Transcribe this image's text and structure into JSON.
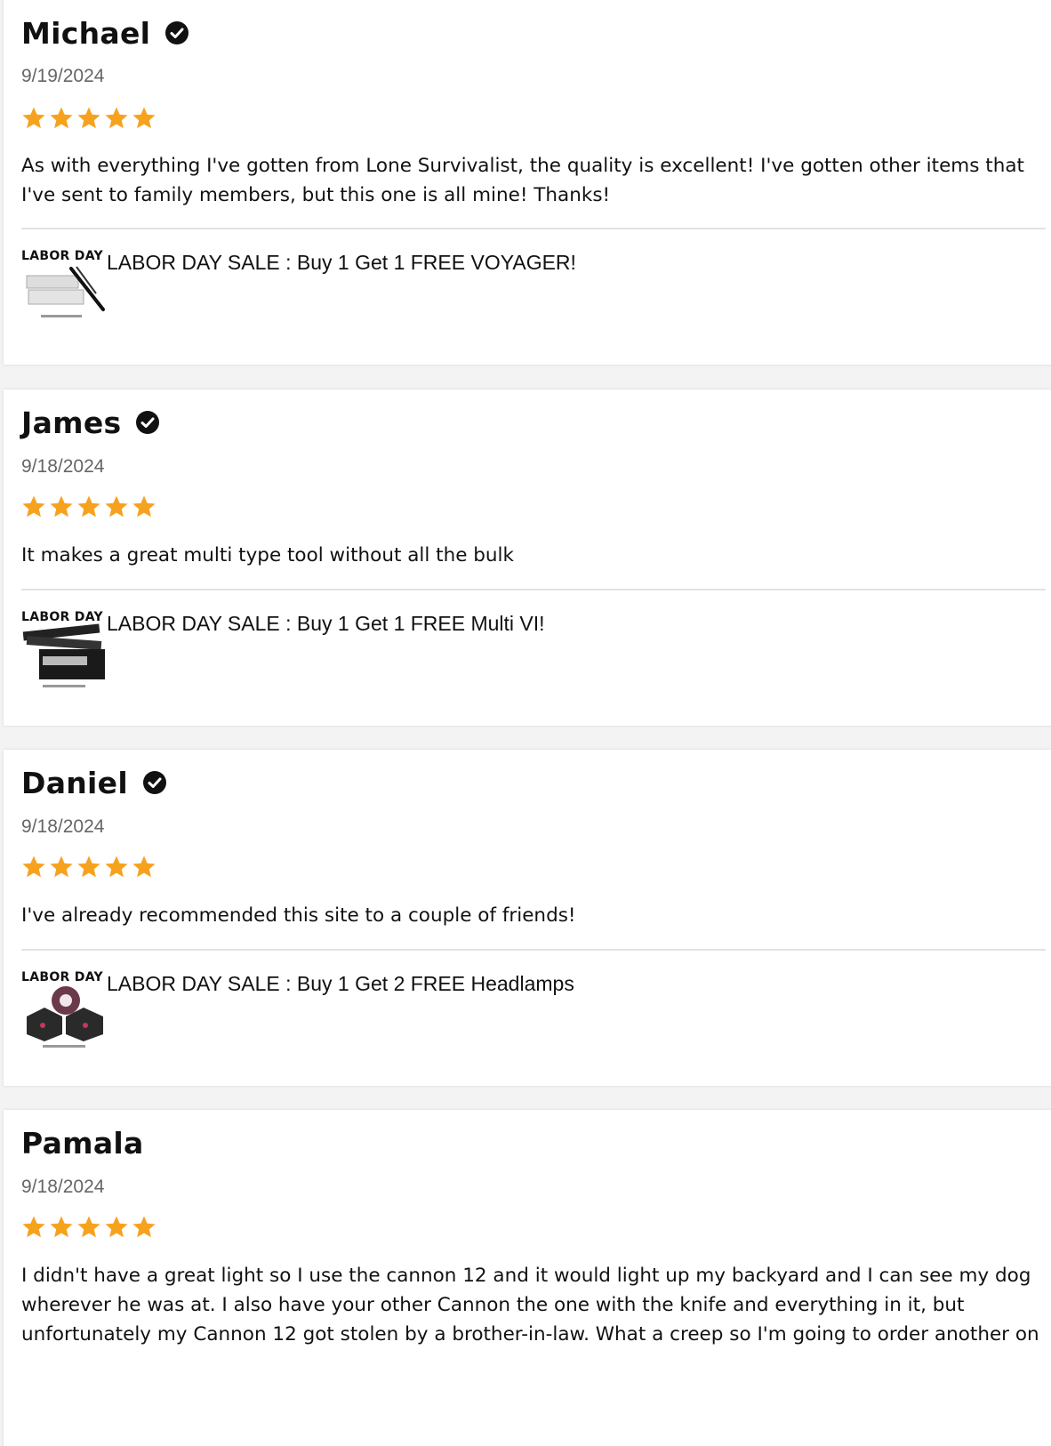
{
  "reviews": [
    {
      "name": "Michael",
      "verified": true,
      "date": "9/19/2024",
      "rating": 5,
      "body": "As with everything I've gotten from Lone Survivalist, the quality is excellent! I've gotten other items that I've sent to family members, but this one is all mine! Thanks!",
      "product": {
        "thumb_label": "LABOR DAY",
        "thumb_icon": "voyager-product-icon",
        "title": "LABOR DAY SALE : Buy 1 Get 1 FREE VOYAGER!"
      }
    },
    {
      "name": "James",
      "verified": true,
      "date": "9/18/2024",
      "rating": 5,
      "body": "It makes a great multi type tool without all the bulk",
      "product": {
        "thumb_label": "LABOR DAY",
        "thumb_icon": "multi-vi-product-icon",
        "title": "LABOR DAY SALE : Buy 1 Get 1 FREE Multi VI!"
      }
    },
    {
      "name": "Daniel",
      "verified": true,
      "date": "9/18/2024",
      "rating": 5,
      "body": "I've already recommended this site to a couple of friends!",
      "product": {
        "thumb_label": "LABOR DAY",
        "thumb_icon": "headlamp-product-icon",
        "title": "LABOR DAY SALE : Buy 1 Get 2 FREE Headlamps"
      }
    },
    {
      "name": "Pamala",
      "verified": false,
      "date": "9/18/2024",
      "rating": 5,
      "body": "I didn't have a great light so I use the cannon 12 and it would light up my backyard and I can see my dog wherever he was at. I also have your other Cannon the one with the knife and everything in it, but unfortunately my Cannon 12 got stolen by a brother-in-law. What a creep so I'm going to order another on"
    }
  ],
  "colors": {
    "star": "#F7A21E",
    "verified": "#111111",
    "date": "#666666",
    "divider": "#E2E2E2",
    "background": "#F3F3F3",
    "card": "#FFFFFF"
  }
}
